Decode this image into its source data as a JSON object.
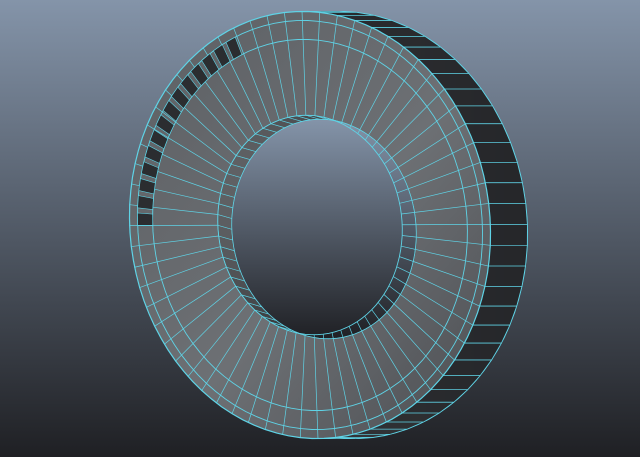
{
  "viewport": {
    "background_top": "#8494a9",
    "background_bottom": "#1f2024",
    "wire_color": "#5fd3e6",
    "mesh": "washer",
    "radial_segments": 64
  }
}
